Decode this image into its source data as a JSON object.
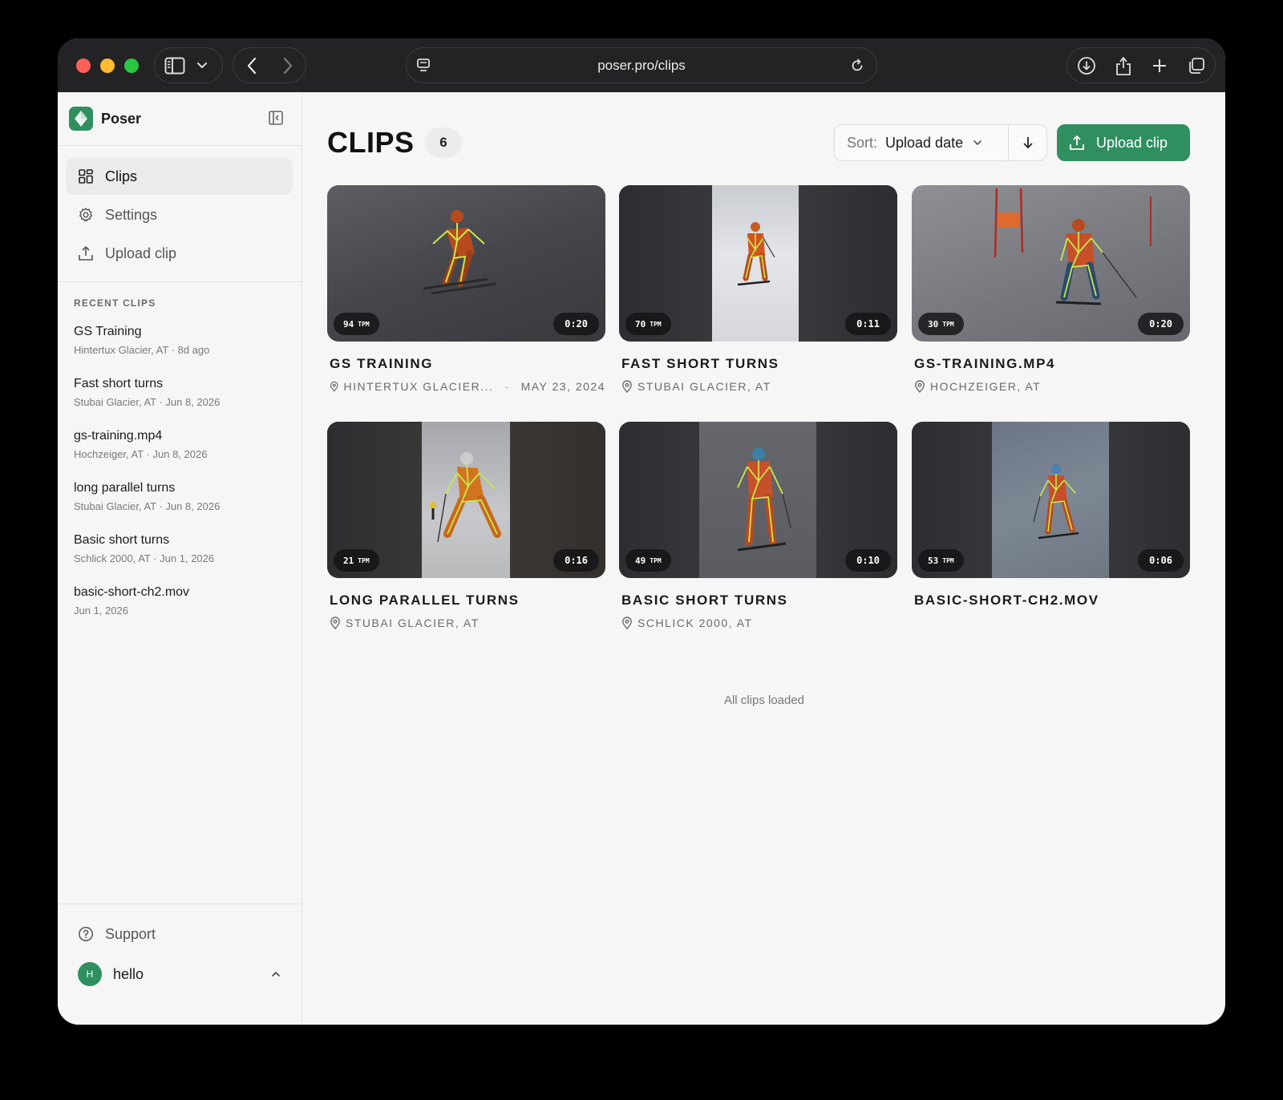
{
  "browser": {
    "url": "poser.pro/clips"
  },
  "sidebar": {
    "brand": "Poser",
    "nav": [
      {
        "label": "Clips",
        "icon": "grid-icon",
        "active": true
      },
      {
        "label": "Settings",
        "icon": "gear-icon",
        "active": false
      },
      {
        "label": "Upload clip",
        "icon": "upload-icon",
        "active": false
      }
    ],
    "recent_title": "RECENT CLIPS",
    "recent": [
      {
        "name": "GS Training",
        "meta": "Hintertux Glacier, AT · 8d ago"
      },
      {
        "name": "Fast short turns",
        "meta": "Stubai Glacier, AT · Jun 8, 2026"
      },
      {
        "name": "gs-training.mp4",
        "meta": "Hochzeiger, AT · Jun 8, 2026"
      },
      {
        "name": "long parallel turns",
        "meta": "Stubai Glacier, AT · Jun 8, 2026"
      },
      {
        "name": "Basic short turns",
        "meta": "Schlick 2000, AT · Jun 1, 2026"
      },
      {
        "name": "basic-short-ch2.mov",
        "meta": "Jun 1, 2026"
      }
    ],
    "support": "Support",
    "user": {
      "initial": "H",
      "name": "hello"
    }
  },
  "main": {
    "title": "CLIPS",
    "count": "6",
    "sort_label": "Sort:",
    "sort_value": "Upload date",
    "upload_label": "Upload clip",
    "footer": "All clips loaded",
    "clips": [
      {
        "title": "GS TRAINING",
        "location": "HINTERTUX GLACIER...",
        "date": "MAY 23, 2024",
        "tpm": "94",
        "duration": "0:20"
      },
      {
        "title": "FAST SHORT TURNS",
        "location": "STUBAI GLACIER, AT",
        "date": "",
        "tpm": "70",
        "duration": "0:11"
      },
      {
        "title": "GS-TRAINING.MP4",
        "location": "HOCHZEIGER, AT",
        "date": "",
        "tpm": "30",
        "duration": "0:20"
      },
      {
        "title": "LONG PARALLEL TURNS",
        "location": "STUBAI GLACIER, AT",
        "date": "",
        "tpm": "21",
        "duration": "0:16"
      },
      {
        "title": "BASIC SHORT TURNS",
        "location": "SCHLICK 2000, AT",
        "date": "",
        "tpm": "49",
        "duration": "0:10"
      },
      {
        "title": "BASIC-SHORT-CH2.MOV",
        "location": "",
        "date": "",
        "tpm": "53",
        "duration": "0:06"
      }
    ],
    "tpm_unit": "TPM"
  },
  "colors": {
    "accent": "#2f8f5f",
    "skeleton": "#c8e84a",
    "jacket": "#d2541f"
  }
}
